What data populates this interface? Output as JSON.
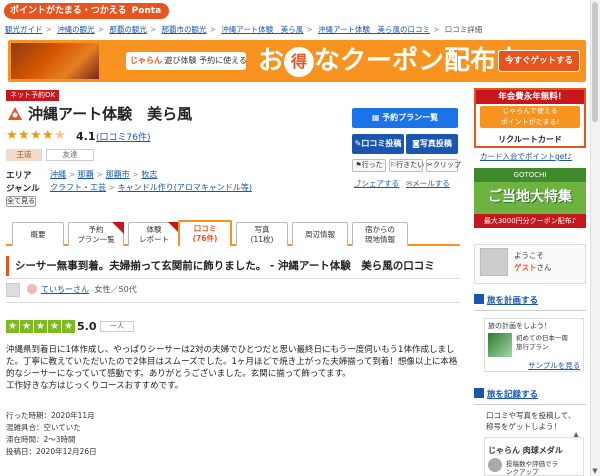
{
  "header": {
    "logo_text": "ポイントがたまる・つかえる",
    "logo_brand": "Ponta"
  },
  "breadcrumb": [
    "観光ガイド",
    "沖縄の観光",
    "那覇の観光",
    "那覇市の観光",
    "沖縄アート体験　美ら風",
    "沖縄アート体験　美ら風の口コミ",
    "口コミ詳細"
  ],
  "banner": {
    "sub_brand": "じゃらん",
    "sub_text": "遊び体験 予約に使える",
    "main_pre": "お",
    "main_otoku": "得",
    "main_post": "なクーポン配布中!",
    "button": "今すぐゲットする"
  },
  "badge": "ネット予約OK",
  "spot": {
    "title": "沖縄アート体験　美ら風",
    "score": "4.1",
    "review_link": "(口コミ76件)",
    "tags": [
      "王道",
      "友達"
    ]
  },
  "info": {
    "area_label": "エリア",
    "area_links": [
      "沖縄",
      "那覇",
      "那覇市",
      "牧志"
    ],
    "genre_label": "ジャンル",
    "genre_links": [
      "クラフト・工芸",
      "キャンドル作り(アロマキャンドル等)"
    ],
    "save_label": "全て見る"
  },
  "actions": {
    "plan_button": "予約プラン一覧",
    "review_button": "口コミ投稿",
    "photo_button": "写真投稿",
    "visited": "行った",
    "want": "行きたい",
    "clip": "クリップ",
    "share": "シェアする",
    "mail": "メールする"
  },
  "tabs": [
    {
      "line1": "概要",
      "line2": ""
    },
    {
      "line1": "予約",
      "line2": "プラン一覧"
    },
    {
      "line1": "体験",
      "line2": "レポート"
    },
    {
      "line1": "口コミ",
      "line2": "(76件)"
    },
    {
      "line1": "写真",
      "line2": "(11枚)"
    },
    {
      "line1": "周辺情報",
      "line2": ""
    },
    {
      "line1": "宿からの",
      "line2": "現地情報"
    }
  ],
  "review": {
    "heading": "シーサー無事到着。夫婦揃って玄関前に飾りました。 - 沖縄アート体験　美ら風の口コミ",
    "user": "ていちーさん",
    "user_meta": "女性／50代",
    "score": "5.0",
    "label": "一人",
    "body": "沖縄県到着日に1体作成し、やっぱりシーサーは2対の夫婦でひとつだと思い最終日にもう一度伺いもう1体作成しました。丁寧に教えていただいたので2体目はスムーズでした。1ヶ月ほどで焼き上がった夫婦揃って到着！想像以上に本格的なシーサーになっていて感動です。ありがとうございました。玄関に揃って飾ってます。\n工作好きな方はじっくりコースおすすめです。",
    "meta": [
      "行った時期：2020年11月",
      "混雑具合：空いていた",
      "滞在時間：2〜3時間",
      "投稿日：2020年12月26日"
    ]
  },
  "sidebar": {
    "ad1_title": "年会費永年無料!",
    "ad1_mid1": "じゃらんで使える",
    "ad1_mid2": "ポイントがたまる!",
    "ad1_foot": "リクルートカード",
    "ad1_link": "カード入会でポイントget♪",
    "ad2_top": "GOTOCHI",
    "ad2_main": "ご当地大特集",
    "ad2_bot": "最大3000円分クーポン配布♪",
    "guest_line1": "ようこそ",
    "guest_line2": "ゲスト",
    "guest_line2b": "さん",
    "plan_head": "旅を計画する",
    "plan_text": "旅の計画をしよう！",
    "plan_desc1": "初めての日本一周",
    "plan_desc2": "旅行プラン",
    "plan_link": "サンプルを見る",
    "record_head": "旅を記録する",
    "record_text1": "口コミや写真を投稿して、",
    "record_text2": "称号をゲットしよう！",
    "medal_title": "じゃらん 肉球メダル",
    "medal_desc1": "投稿数や評価でラ",
    "medal_desc2": "ンクアップ"
  }
}
